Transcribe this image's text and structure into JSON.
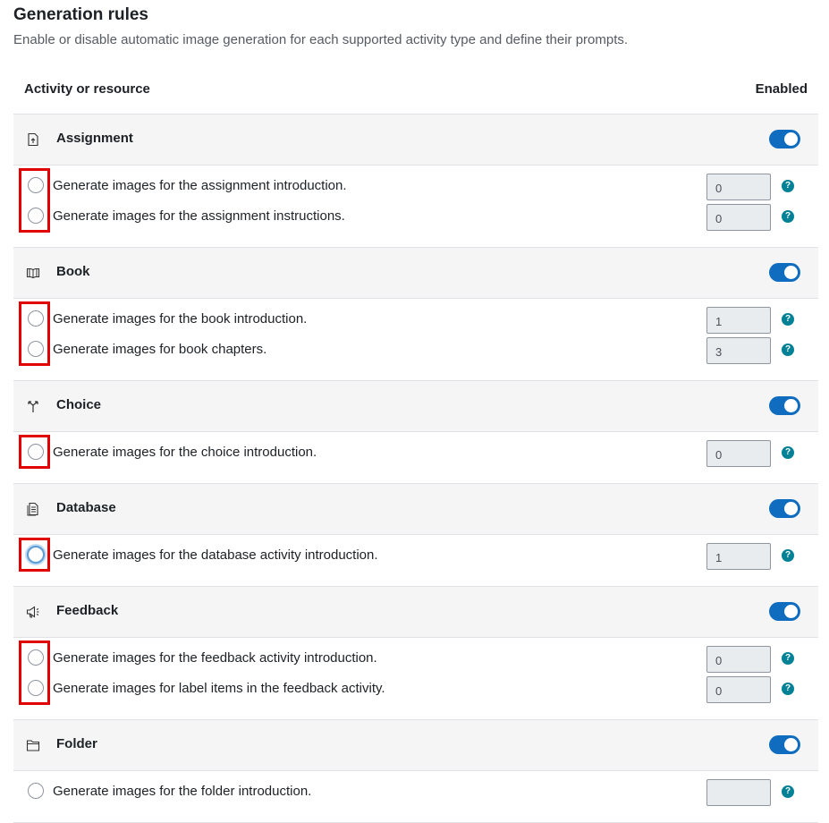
{
  "page": {
    "title": "Generation rules",
    "description": "Enable or disable automatic image generation for each supported activity type and define their prompts."
  },
  "table": {
    "col_activity": "Activity or resource",
    "col_enabled": "Enabled"
  },
  "colors": {
    "toggle_on": "#0f6cbf",
    "help": "#008196",
    "highlight": "#e00000"
  },
  "groups": [
    {
      "name": "Assignment",
      "icon": "assignment-icon",
      "enabled": true,
      "rules": [
        {
          "label": "Generate images for the assignment introduction.",
          "value": "0"
        },
        {
          "label": "Generate images for the assignment instructions.",
          "value": "0"
        }
      ]
    },
    {
      "name": "Book",
      "icon": "book-icon",
      "enabled": true,
      "rules": [
        {
          "label": "Generate images for the book introduction.",
          "value": "1"
        },
        {
          "label": "Generate images for book chapters.",
          "value": "3"
        }
      ]
    },
    {
      "name": "Choice",
      "icon": "choice-icon",
      "enabled": true,
      "rules": [
        {
          "label": "Generate images for the choice introduction.",
          "value": "0"
        }
      ]
    },
    {
      "name": "Database",
      "icon": "database-icon",
      "enabled": true,
      "rules": [
        {
          "label": "Generate images for the database activity introduction.",
          "value": "1"
        }
      ]
    },
    {
      "name": "Feedback",
      "icon": "feedback-icon",
      "enabled": true,
      "rules": [
        {
          "label": "Generate images for the feedback activity introduction.",
          "value": "0"
        },
        {
          "label": "Generate images for label items in the feedback activity.",
          "value": "0"
        }
      ]
    },
    {
      "name": "Folder",
      "icon": "folder-icon",
      "enabled": true,
      "rules": [
        {
          "label": "Generate images for the folder introduction.",
          "value": ""
        }
      ]
    }
  ]
}
